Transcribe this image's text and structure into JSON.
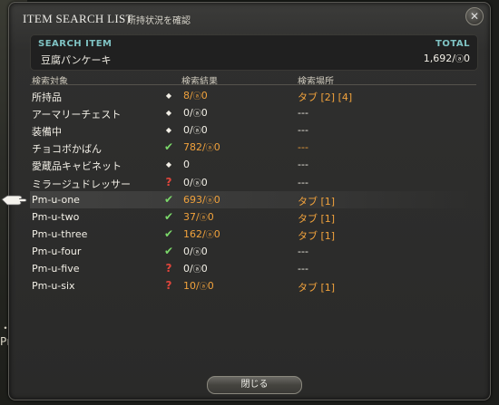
{
  "window": {
    "title": "ITEM SEARCH LIST",
    "subtitle": "所持状況を確認",
    "close_icon": "close-icon"
  },
  "search": {
    "label": "SEARCH ITEM",
    "item_name": "豆腐パンケーキ",
    "total_label": "TOTAL",
    "total_value": "1,692/",
    "total_hq": "0"
  },
  "columns": {
    "target": "検索対象",
    "result": "検索結果",
    "location": "検索場所"
  },
  "rows": [
    {
      "name": "所持品",
      "icon": "diamond-icon",
      "result": "8/",
      "hq": "0",
      "result_color": "orange",
      "location": "タブ [2] [4]",
      "location_color": "orange"
    },
    {
      "name": "アーマリーチェスト",
      "icon": "diamond-icon",
      "result": "0/",
      "hq": "0",
      "result_color": "white",
      "location": "---",
      "location_color": "white"
    },
    {
      "name": "装備中",
      "icon": "diamond-icon",
      "result": "0/",
      "hq": "0",
      "result_color": "white",
      "location": "---",
      "location_color": "white"
    },
    {
      "name": "チョコボかばん",
      "icon": "check-icon",
      "result": "782/",
      "hq": "0",
      "result_color": "orange",
      "location": "---",
      "location_color": "orange"
    },
    {
      "name": "愛蔵品キャビネット",
      "icon": "diamond-icon",
      "result": "0",
      "hq": "",
      "result_color": "white",
      "location": "---",
      "location_color": "white"
    },
    {
      "name": "ミラージュドレッサー",
      "icon": "question-icon",
      "result": "0/",
      "hq": "0",
      "result_color": "white",
      "location": "---",
      "location_color": "white"
    },
    {
      "name": "Pm-u-one",
      "icon": "check-icon",
      "result": "693/",
      "hq": "0",
      "result_color": "orange",
      "location": "タブ [1]",
      "location_color": "orange"
    },
    {
      "name": "Pm-u-two",
      "icon": "check-icon",
      "result": "37/",
      "hq": "0",
      "result_color": "orange",
      "location": "タブ [1]",
      "location_color": "orange"
    },
    {
      "name": "Pm-u-three",
      "icon": "check-icon",
      "result": "162/",
      "hq": "0",
      "result_color": "orange",
      "location": "タブ [1]",
      "location_color": "orange"
    },
    {
      "name": "Pm-u-four",
      "icon": "check-icon",
      "result": "0/",
      "hq": "0",
      "result_color": "white",
      "location": "---",
      "location_color": "white"
    },
    {
      "name": "Pm-u-five",
      "icon": "question-icon",
      "result": "0/",
      "hq": "0",
      "result_color": "white",
      "location": "---",
      "location_color": "white"
    },
    {
      "name": "Pm-u-six",
      "icon": "question-icon",
      "result": "10/",
      "hq": "0",
      "result_color": "orange",
      "location": "タブ [1]",
      "location_color": "orange"
    }
  ],
  "selected_row": 6,
  "footer": {
    "close_label": "閉じる"
  },
  "background": {
    "text_line1": "・コ",
    "text_line2": "Pm"
  },
  "colors": {
    "accent": "#7fc3c4",
    "orange": "#f1a23c",
    "check": "#7bd86a",
    "question": "#e0453b"
  }
}
